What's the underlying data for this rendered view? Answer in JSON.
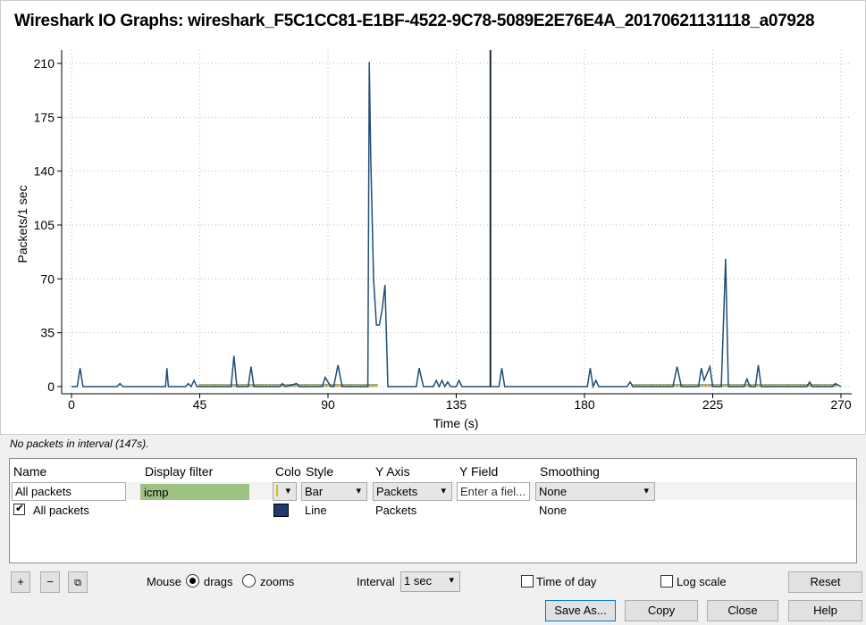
{
  "window_title": "Wireshark IO Graphs: wireshark_F5C1CC81-E1BF-4522-9C78-5089E2E76E4A_20170621131118_a07928",
  "status": "No packets in interval (147s).",
  "table": {
    "headers": [
      "Name",
      "Display filter",
      "Colo",
      "Style",
      "Y Axis",
      "Y Field",
      "Smoothing"
    ],
    "edit_row": {
      "name": "All packets",
      "filter": "icmp",
      "style": "Bar",
      "y_axis": "Packets",
      "y_field_placeholder": "Enter a fiel...",
      "smoothing": "None"
    },
    "row": {
      "name": "All packets",
      "checked": true,
      "color": "#1f3a6e",
      "style": "Line",
      "y_axis": "Packets",
      "smoothing": "None"
    }
  },
  "controls": {
    "add": "+",
    "remove": "−",
    "copy_icon": "copy-graph",
    "mouse_label": "Mouse",
    "drags": "drags",
    "zooms": "zooms",
    "interval_label": "Interval",
    "interval": "1 sec",
    "time_of_day": "Time of day",
    "log_scale": "Log scale",
    "reset": "Reset",
    "save_as": "Save As...",
    "copy": "Copy",
    "close": "Close",
    "help": "Help"
  },
  "chart_data": {
    "type": "line",
    "xlabel": "Time (s)",
    "ylabel": "Packets/1 sec",
    "xlim": [
      0,
      270
    ],
    "ylim": [
      0,
      210
    ],
    "xticks": [
      0,
      45,
      90,
      135,
      180,
      225,
      270
    ],
    "yticks": [
      0,
      35,
      70,
      105,
      140,
      175,
      210
    ],
    "cursor_time": 147,
    "series": [
      {
        "name": "All packets",
        "style": "line",
        "color": "#1f4e79",
        "points": [
          [
            0,
            0
          ],
          [
            2,
            0
          ],
          [
            3,
            12
          ],
          [
            4,
            0
          ],
          [
            16,
            0
          ],
          [
            17,
            2
          ],
          [
            18,
            0
          ],
          [
            33,
            0
          ],
          [
            33.5,
            12
          ],
          [
            34,
            0
          ],
          [
            40,
            0
          ],
          [
            41,
            2
          ],
          [
            42,
            0
          ],
          [
            43,
            4
          ],
          [
            44,
            0
          ],
          [
            56,
            0
          ],
          [
            57,
            20
          ],
          [
            58,
            0
          ],
          [
            62,
            0
          ],
          [
            63,
            13
          ],
          [
            64,
            0
          ],
          [
            73,
            0
          ],
          [
            74,
            2
          ],
          [
            75,
            0
          ],
          [
            79,
            2
          ],
          [
            80,
            0
          ],
          [
            88,
            0
          ],
          [
            89,
            6
          ],
          [
            90,
            3
          ],
          [
            91,
            0
          ],
          [
            92,
            0
          ],
          [
            93.5,
            14
          ],
          [
            95,
            0
          ],
          [
            104,
            0
          ],
          [
            104.5,
            211
          ],
          [
            105,
            150
          ],
          [
            106,
            70
          ],
          [
            107,
            40
          ],
          [
            108,
            40
          ],
          [
            109,
            50
          ],
          [
            110,
            66
          ],
          [
            111,
            0
          ],
          [
            121,
            0
          ],
          [
            122,
            12
          ],
          [
            123.5,
            0
          ],
          [
            127,
            0
          ],
          [
            128,
            4
          ],
          [
            129,
            0
          ],
          [
            130,
            4
          ],
          [
            131,
            0
          ],
          [
            132,
            3
          ],
          [
            133,
            0
          ],
          [
            135,
            0
          ],
          [
            136,
            4
          ],
          [
            137,
            0
          ],
          [
            150,
            0
          ],
          [
            151,
            12
          ],
          [
            152,
            0
          ],
          [
            181,
            0
          ],
          [
            182,
            12
          ],
          [
            183,
            0
          ],
          [
            184,
            4
          ],
          [
            185,
            0
          ],
          [
            195,
            0
          ],
          [
            196,
            3
          ],
          [
            197,
            0
          ],
          [
            211,
            0
          ],
          [
            212.5,
            13
          ],
          [
            214,
            0
          ],
          [
            220,
            0
          ],
          [
            221,
            12
          ],
          [
            222,
            4
          ],
          [
            224,
            13
          ],
          [
            225,
            0
          ],
          [
            228,
            0
          ],
          [
            229.5,
            83
          ],
          [
            230.5,
            0
          ],
          [
            236,
            0
          ],
          [
            237,
            5
          ],
          [
            238,
            0
          ],
          [
            240,
            0
          ],
          [
            241,
            14
          ],
          [
            242,
            0
          ],
          [
            258,
            0
          ],
          [
            259,
            3
          ],
          [
            260,
            0
          ],
          [
            267,
            0
          ],
          [
            268,
            2
          ],
          [
            270,
            0
          ]
        ]
      },
      {
        "name": "icmp",
        "style": "bar",
        "color": "#d8d040",
        "ranges": [
          [
            45,
            107,
            1.5
          ],
          [
            197,
            268,
            1.5
          ]
        ]
      }
    ]
  }
}
